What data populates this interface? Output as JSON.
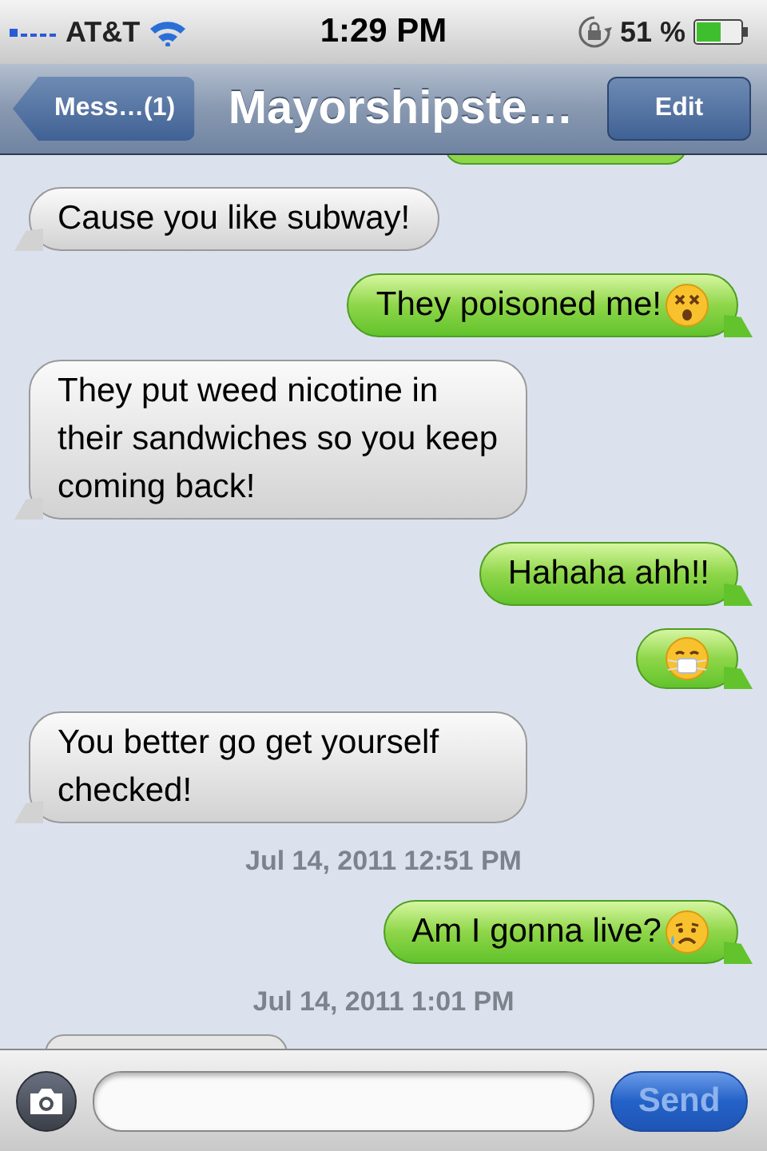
{
  "status_bar": {
    "carrier": "AT&T",
    "time": "1:29 PM",
    "battery": "51 %"
  },
  "nav": {
    "back": "Mess…(1)",
    "title": "Mayorshipste…",
    "edit": "Edit"
  },
  "messages": [
    {
      "kind": "fragment",
      "outgoing": true
    },
    {
      "kind": "bubble",
      "outgoing": false,
      "text": "Cause you like subway!"
    },
    {
      "kind": "bubble",
      "outgoing": true,
      "text": "They poisoned me!",
      "emoji": {
        "kind": "dizzy"
      }
    },
    {
      "kind": "bubble",
      "outgoing": false,
      "text": "They put weed nicotine in their sandwiches so you keep coming back!"
    },
    {
      "kind": "bubble",
      "outgoing": true,
      "text": "Hahaha ahh!!"
    },
    {
      "kind": "bubble",
      "outgoing": true,
      "emoji": {
        "kind": "mask"
      }
    },
    {
      "kind": "bubble",
      "outgoing": false,
      "text": "You better go get yourself checked!"
    },
    {
      "kind": "timestamp",
      "text": "Jul 14, 2011 12:51 PM"
    },
    {
      "kind": "bubble",
      "outgoing": true,
      "text": "Am I gonna live?",
      "emoji": {
        "kind": "sad"
      }
    },
    {
      "kind": "timestamp",
      "text": "Jul 14, 2011 1:01 PM"
    },
    {
      "kind": "fragment",
      "outgoing": false
    }
  ],
  "send_button": {
    "label": "Send",
    "disabled": true
  }
}
